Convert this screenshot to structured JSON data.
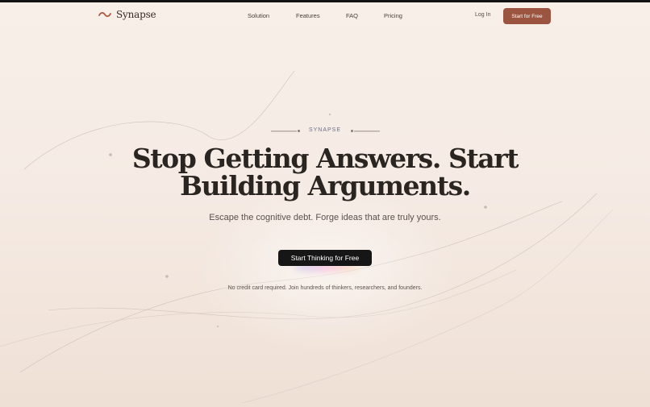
{
  "nav": {
    "brand": "Synapse",
    "links": [
      "Solution",
      "Features",
      "FAQ",
      "Pricing"
    ],
    "login_label": "Log In",
    "cta_label": "Start for Free"
  },
  "hero": {
    "eyebrow": "SYNAPSE",
    "headline_line1": "Stop Getting Answers. Start",
    "headline_line2": "Building Arguments.",
    "subheadline": "Escape the cognitive debt. Forge ideas that are truly yours.",
    "cta_label": "Start Thinking for Free",
    "note": "No credit card required. Join hundreds of thinkers, researchers, and founders."
  },
  "colors": {
    "accent": "#9a5440",
    "background": "#f7eee8",
    "headline": "#2b2522",
    "primary_button": "#161616"
  },
  "icons": {
    "logo": "squiggle-icon"
  }
}
